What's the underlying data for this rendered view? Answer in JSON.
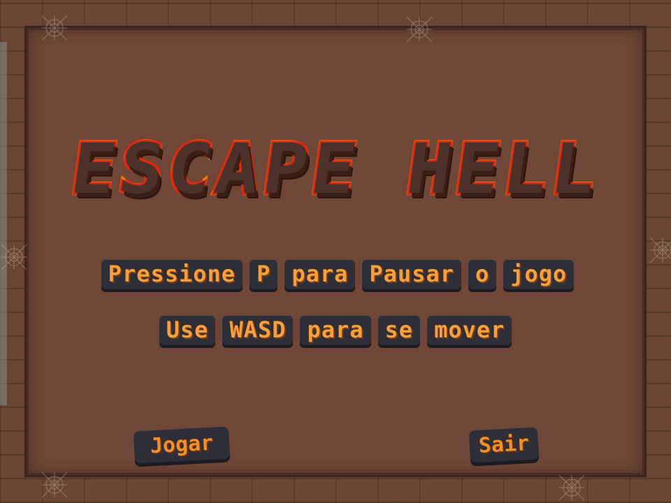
{
  "title": "ESCAPE HELL",
  "instructions": {
    "line1": [
      "Pressione",
      "P",
      "para",
      "Pausar",
      "o",
      "jogo"
    ],
    "line2": [
      "Use",
      "WASD",
      "para",
      "se",
      "mover"
    ]
  },
  "buttons": {
    "play": "Jogar",
    "exit": "Sair"
  },
  "colors": {
    "title_outer": "#f07a12",
    "title_inner": "#d92a10",
    "text": "#f5a040",
    "chip_bg": "#2e2e38",
    "background": "#704737"
  }
}
